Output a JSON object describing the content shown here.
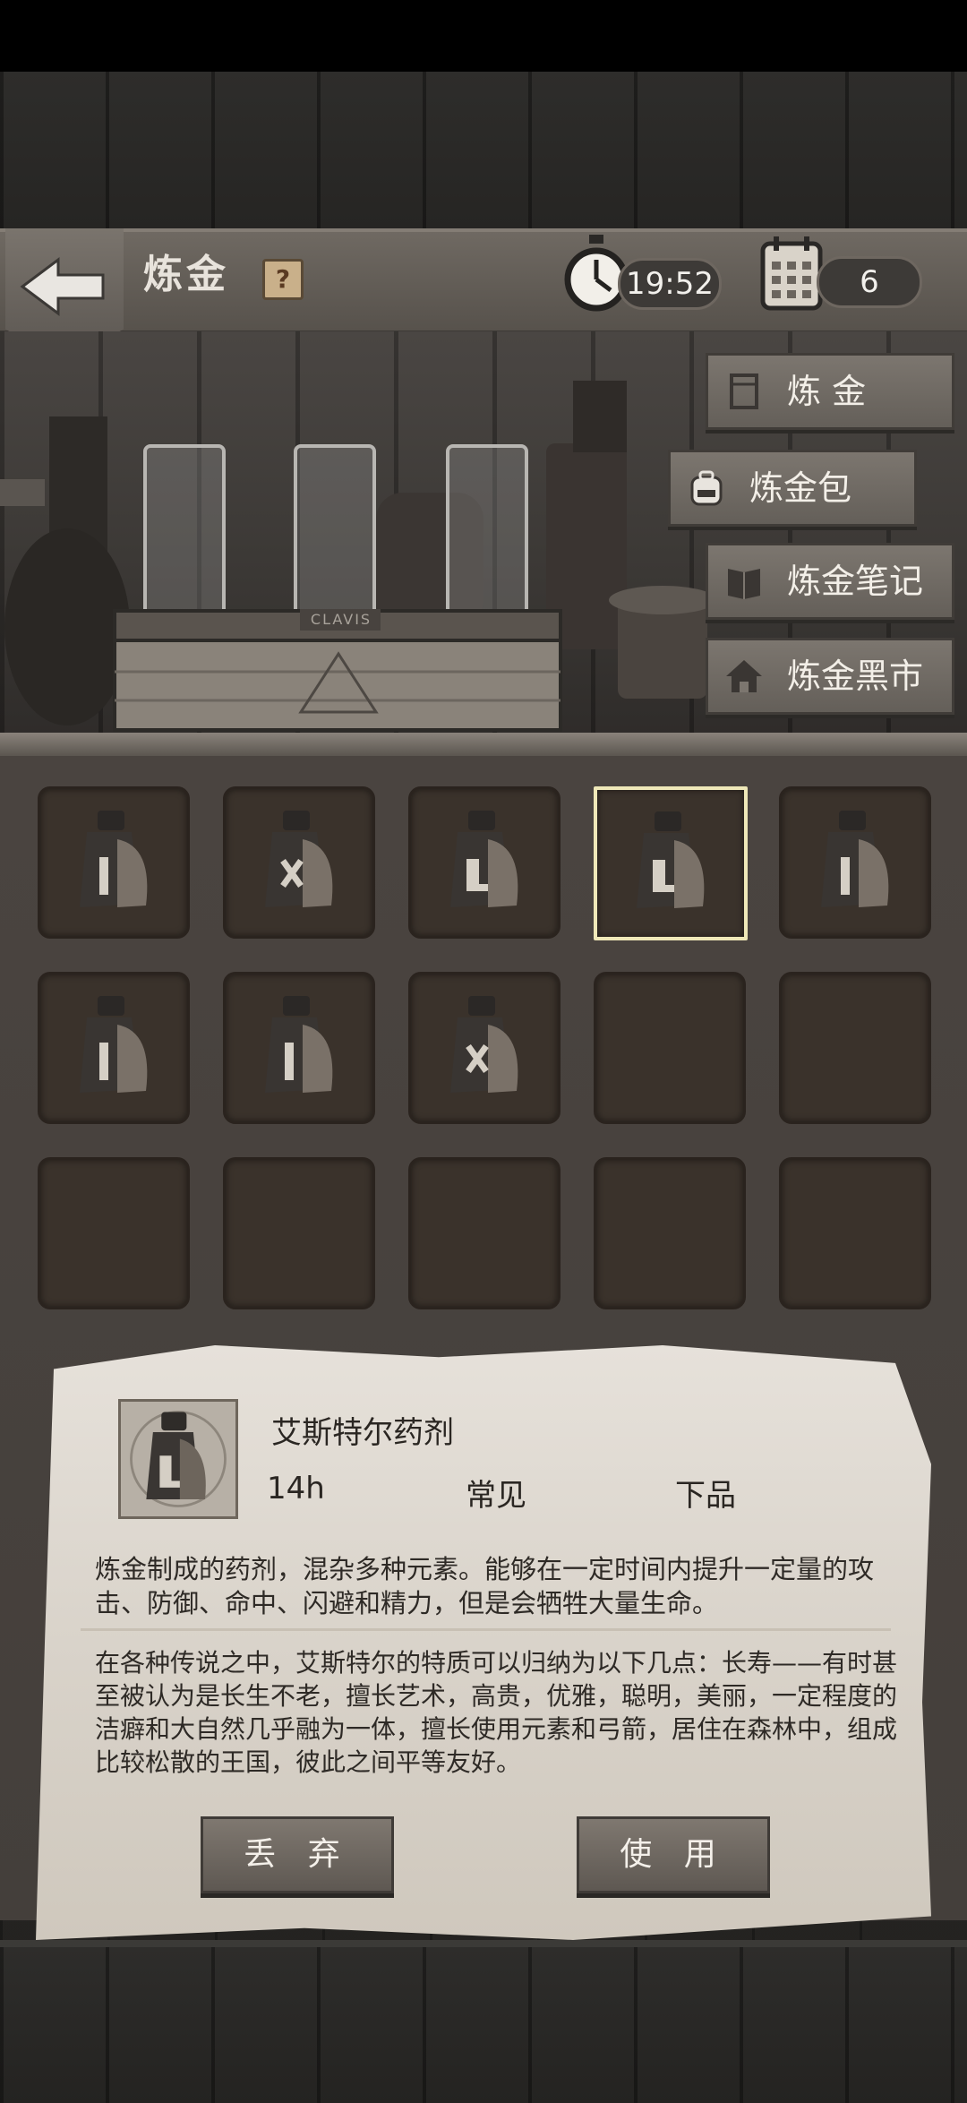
{
  "header": {
    "title": "炼金",
    "help_label": "?",
    "timer": "19:52",
    "day_count": "6"
  },
  "menu": [
    {
      "label": "炼 金",
      "icon": "alchemy-icon"
    },
    {
      "label": "炼金包",
      "icon": "backpack-icon"
    },
    {
      "label": "炼金笔记",
      "icon": "book-icon"
    },
    {
      "label": "炼金黑市",
      "icon": "house-icon"
    }
  ],
  "scene": {
    "box_label": "CLAVIS"
  },
  "inventory": {
    "slots": [
      {
        "filled": true,
        "rune": "thin"
      },
      {
        "filled": true,
        "rune": "x"
      },
      {
        "filled": true,
        "rune": "hook"
      },
      {
        "filled": true,
        "rune": "hook",
        "selected": true
      },
      {
        "filled": true,
        "rune": "thin"
      },
      {
        "filled": true,
        "rune": "thin"
      },
      {
        "filled": true,
        "rune": "thin"
      },
      {
        "filled": true,
        "rune": "x"
      },
      {
        "filled": false
      },
      {
        "filled": false
      },
      {
        "filled": false
      },
      {
        "filled": false
      },
      {
        "filled": false
      },
      {
        "filled": false
      },
      {
        "filled": false
      }
    ]
  },
  "detail": {
    "name": "艾斯特尔药剂",
    "duration": "14h",
    "rarity": "常见",
    "grade": "下品",
    "effect": "炼金制成的药剂，混杂多种元素。能够在一定时间内提升一定量的攻击、防御、命中、闪避和精力，但是会牺牲大量生命。",
    "lore": "在各种传说之中，艾斯特尔的特质可以归纳为以下几点：长寿——有时甚至被认为是长生不老，擅长艺术，高贵，优雅，聪明，美丽，一定程度的洁癖和大自然几乎融为一体，擅长使用元素和弓箭，居住在森林中，组成比较松散的王国，彼此之间平等友好。",
    "discard_label": "丢 弃",
    "use_label": "使 用"
  },
  "colors": {
    "parchment": "#dcd6cd",
    "wood_dark": "#2b2a28",
    "selected_border": "#efe8b8"
  }
}
